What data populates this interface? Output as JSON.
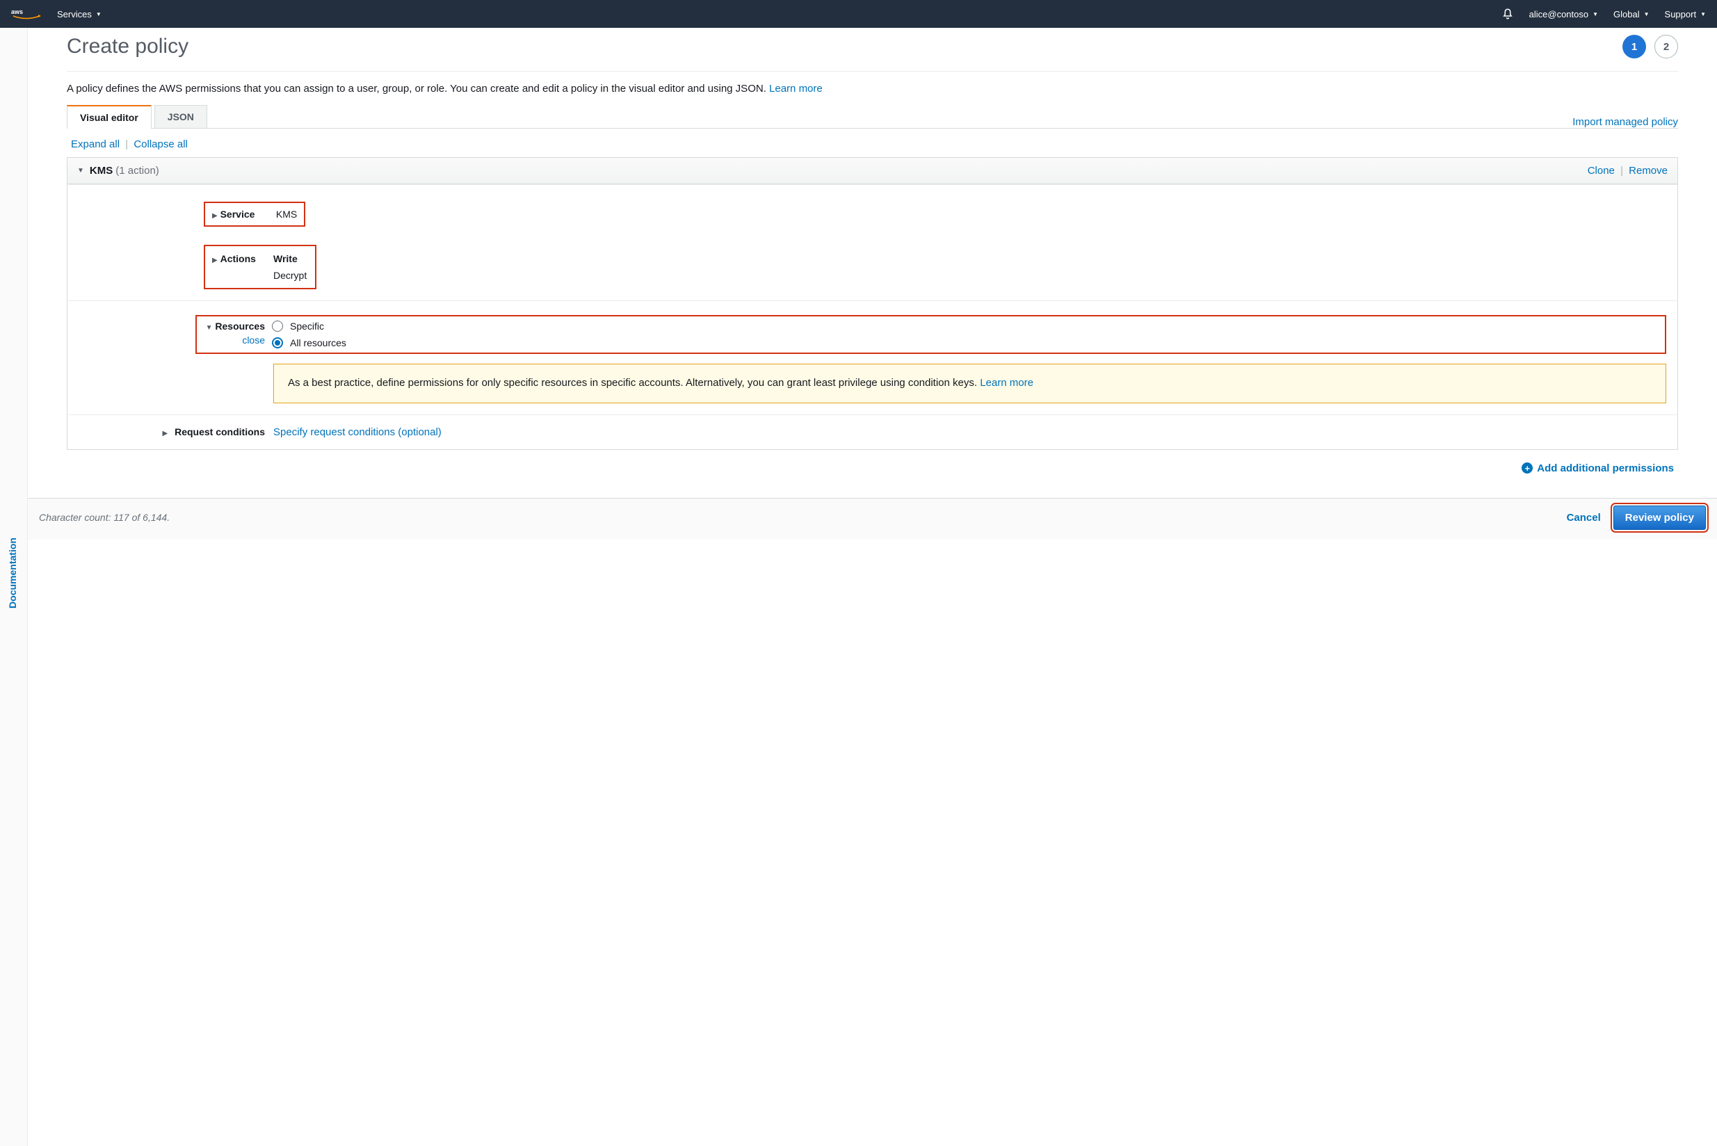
{
  "topnav": {
    "services_label": "Services",
    "user_label": "alice@contoso",
    "region_label": "Global",
    "support_label": "Support"
  },
  "sidebar": {
    "documentation_label": "Documentation"
  },
  "page": {
    "title": "Create policy",
    "steps": {
      "current": "1",
      "next": "2"
    },
    "description": "A policy defines the AWS permissions that you can assign to a user, group, or role. You can create and edit a policy in the visual editor and using JSON.",
    "learn_more": "Learn more"
  },
  "tabs": {
    "visual_editor": "Visual editor",
    "json": "JSON",
    "import": "Import managed policy"
  },
  "expand": {
    "expand_all": "Expand all",
    "collapse_all": "Collapse all"
  },
  "block": {
    "title": "KMS",
    "count": "(1 action)",
    "clone": "Clone",
    "remove": "Remove"
  },
  "service": {
    "label": "Service",
    "value": "KMS"
  },
  "actions": {
    "label": "Actions",
    "group": "Write",
    "item": "Decrypt"
  },
  "resources": {
    "label": "Resources",
    "close": "close",
    "opt_specific": "Specific",
    "opt_all": "All resources",
    "warn_text": "As a best practice, define permissions for only specific resources in specific accounts. Alternatively, you can grant least privilege using condition keys.",
    "warn_learn_more": "Learn more"
  },
  "conditions": {
    "label": "Request conditions",
    "link": "Specify request conditions (optional)"
  },
  "add_perm": "Add additional permissions",
  "footer": {
    "char_count": "Character count: 117 of 6,144.",
    "cancel": "Cancel",
    "review": "Review policy"
  }
}
